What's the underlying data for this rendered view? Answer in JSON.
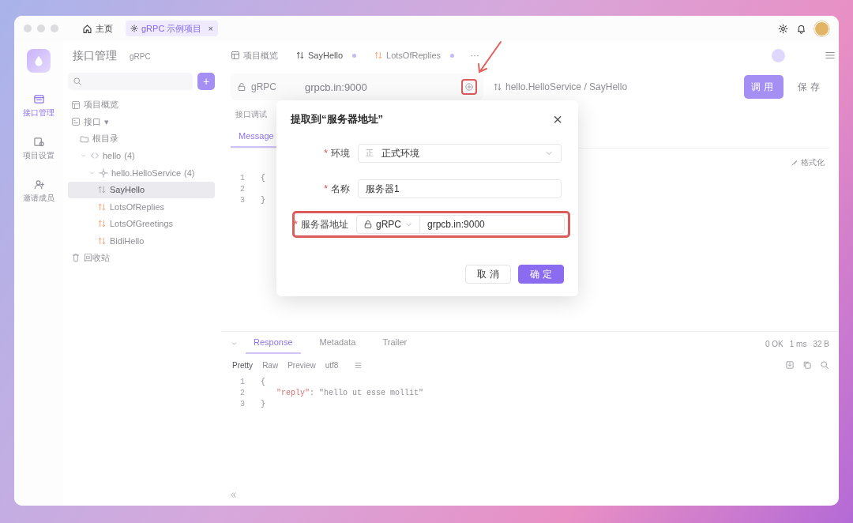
{
  "title_bar": {
    "tabs": [
      {
        "label": "主页",
        "kind": "home",
        "selected": false
      },
      {
        "label": "gRPC 示例项目",
        "kind": "project",
        "selected": true,
        "close": "×"
      }
    ]
  },
  "rail": [
    {
      "label": "接口管理",
      "kind": "api",
      "selected": true
    },
    {
      "label": "项目设置",
      "kind": "settings",
      "selected": false
    },
    {
      "label": "邀请成员",
      "kind": "invite",
      "selected": false
    }
  ],
  "panel": {
    "title": "接口管理",
    "subtitle": "gRPC",
    "add": "+",
    "tree": [
      {
        "label": "项目概览",
        "kind": "overview",
        "selected": false
      },
      {
        "label": "接口",
        "kind": "group",
        "caret": "▾",
        "selected": false,
        "children": [
          {
            "label": "根目录",
            "kind": "folder",
            "selected": false
          },
          {
            "label": "hello",
            "count": "(4)",
            "kind": "proto",
            "expanded": true,
            "selected": false,
            "children": [
              {
                "label": "hello.HelloService",
                "count": "(4)",
                "kind": "service",
                "expanded": true,
                "selected": false,
                "children": [
                  {
                    "label": "SayHello",
                    "kind": "unary",
                    "selected": true
                  },
                  {
                    "label": "LotsOfReplies",
                    "kind": "stream",
                    "selected": false
                  },
                  {
                    "label": "LotsOfGreetings",
                    "kind": "stream",
                    "selected": false
                  },
                  {
                    "label": "BidiHello",
                    "kind": "stream",
                    "selected": false
                  }
                ]
              }
            ]
          }
        ]
      },
      {
        "label": "回收站",
        "kind": "trash",
        "selected": false
      }
    ]
  },
  "main": {
    "tabs": [
      {
        "label": "项目概览",
        "kind": "overview",
        "selected": false,
        "modified": false
      },
      {
        "label": "SayHello",
        "kind": "unary",
        "selected": true,
        "modified": true
      },
      {
        "label": "LotsOfReplies",
        "kind": "stream",
        "selected": false,
        "modified": true
      }
    ],
    "more": "···",
    "address": {
      "protocol": "gRPC",
      "url": "grpcb.in:9000",
      "extract_highlighted": true,
      "method_path": "hello.HelloService / SayHello",
      "invoke": "调用",
      "save": "保存"
    },
    "request": {
      "section": "接口调试",
      "tabs": [
        {
          "label": "Message",
          "selected": true
        }
      ],
      "format": "格式化",
      "code": [
        {
          "n": "1",
          "text": "{"
        },
        {
          "n": "2"
        },
        {
          "n": "3",
          "text": "}"
        }
      ]
    },
    "response": {
      "tabs": [
        {
          "label": "Response",
          "selected": true
        },
        {
          "label": "Metadata",
          "selected": false
        },
        {
          "label": "Trailer",
          "selected": false
        }
      ],
      "status": [
        "0 OK",
        "1 ms",
        "32 B"
      ],
      "views": [
        {
          "label": "Pretty",
          "selected": true
        },
        {
          "label": "Raw",
          "selected": false
        },
        {
          "label": "Preview",
          "selected": false
        },
        {
          "label": "utf8",
          "selected": false
        }
      ],
      "code": [
        {
          "n": "1",
          "text": "{"
        },
        {
          "n": "2",
          "key": "\"reply\"",
          "sep": ":",
          "value": "\"hello ut esse mollit\""
        },
        {
          "n": "3",
          "text": "}"
        }
      ]
    }
  },
  "dialog": {
    "title": "提取到“服务器地址”",
    "close": "×",
    "fields": [
      {
        "label": "环境",
        "required_mark": "*",
        "kind": "select",
        "badge": "正",
        "value": "正式环境",
        "highlighted": false
      },
      {
        "label": "名称",
        "required_mark": "*",
        "kind": "input",
        "value": "服务器1",
        "highlighted": false
      },
      {
        "label": "服务器地址",
        "required_mark": "*",
        "kind": "address",
        "protocol": "gRPC",
        "value": "grpcb.in:9000",
        "highlighted": true
      }
    ],
    "buttons": [
      {
        "label": "取消",
        "kind": "secondary"
      },
      {
        "label": "确定",
        "kind": "primary"
      }
    ]
  },
  "annotation": {
    "arrow": true
  }
}
